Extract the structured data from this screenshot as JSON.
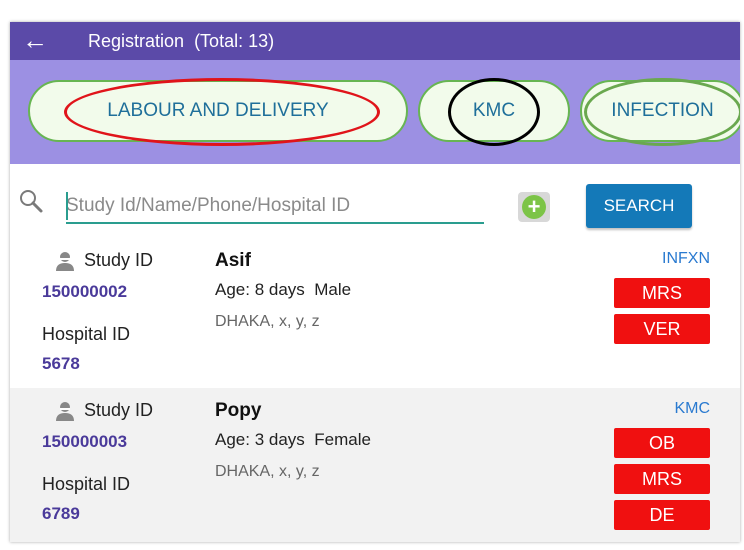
{
  "app_bar": {
    "back_icon": "arrow-left-icon",
    "title": "Registration",
    "total": "(Total: 13)"
  },
  "tabs": [
    {
      "label": "LABOUR AND DELIVERY"
    },
    {
      "label": "KMC"
    },
    {
      "label": "INFECTION"
    }
  ],
  "search": {
    "placeholder": "Study Id/Name/Phone/Hospital ID",
    "button_label": "SEARCH"
  },
  "records": [
    {
      "study_id_label": "Study ID",
      "study_id": "150000002",
      "hospital_id_label": "Hospital ID",
      "hospital_id": "5678",
      "name": "Asif",
      "age": "Age: 8 days",
      "sex": "Male",
      "location": "DHAKA, x, y, z",
      "category": "INFXN",
      "badges": [
        "MRS",
        "VER"
      ]
    },
    {
      "study_id_label": "Study ID",
      "study_id": "150000003",
      "hospital_id_label": "Hospital ID",
      "hospital_id": "6789",
      "name": "Popy",
      "age": "Age: 3 days",
      "sex": "Female",
      "location": "DHAKA, x, y, z",
      "category": "KMC",
      "badges": [
        "OB",
        "MRS",
        "DE"
      ]
    }
  ],
  "colors": {
    "app_bar": "#5b4aa8",
    "tab_strip": "#9c90e3",
    "tab_border": "#67b552",
    "badge": "#f01010",
    "search_button": "#1479b8",
    "id_value": "#4a3a9a",
    "annotation_red": "#e0141a",
    "annotation_black": "#000000",
    "annotation_green": "#6aa84f"
  }
}
